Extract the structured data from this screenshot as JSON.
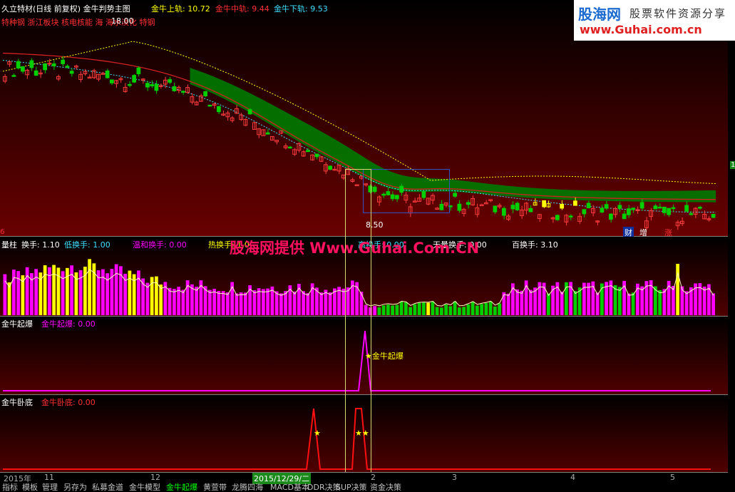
{
  "main_panel": {
    "title": "久立特材(日线 前复权) 金牛判势主图",
    "upper_label": "金牛上轨: 10.72",
    "mid_label": "金牛中轨: 9.44",
    "lower_label": "金牛下轨: 9.53",
    "concepts": "特种钢 浙江板块 核电核能 海 海水淡化 特钢",
    "high_price": "18.00",
    "low_price": "8.50",
    "tags": [
      "财",
      "增",
      "涨"
    ],
    "left_edge_mark": "6",
    "right_edge_mark": "1"
  },
  "volume_panel": {
    "title": "量柱",
    "labels": [
      "换手: 1.10",
      "低换手: 1.00",
      "温和换手: 0.00",
      "热换手: 1.0",
      "高换手: 0.00",
      "天量换手: 0.00",
      "百换手: 3.10"
    ],
    "watermark": "股海网提供 Www.Guhai.Com.CN"
  },
  "burst_panel": {
    "title": "金牛起爆",
    "label": "金牛起爆: 0.00",
    "signal": "★金牛起爆"
  },
  "bottom_panel": {
    "title": "金牛卧底",
    "label": "金牛卧底: 0.00",
    "stars": [
      "★",
      "★★"
    ]
  },
  "axis": {
    "year": "2015年",
    "marks": [
      "11",
      "12",
      "2",
      "3",
      "4",
      "5"
    ],
    "cursor_date": "2015/12/29/二"
  },
  "logo": {
    "brand": "股海网",
    "slogan": "股票软件资源分享",
    "url": "www.Guhai.com.cn"
  },
  "tabs": [
    "指标",
    "模板",
    "管理",
    "另存为",
    "私募金道",
    "金牛模型",
    "金牛起爆",
    "黄萱带",
    "龙腾四海",
    "MACD基本",
    "DDR决策",
    "SUP决策",
    "资金决策"
  ],
  "colors": {
    "up": "#ff3c3c",
    "down": "#00d000",
    "cloud": "#007a00",
    "magenta": "#ff00ff",
    "gold": "#ffff00"
  }
}
